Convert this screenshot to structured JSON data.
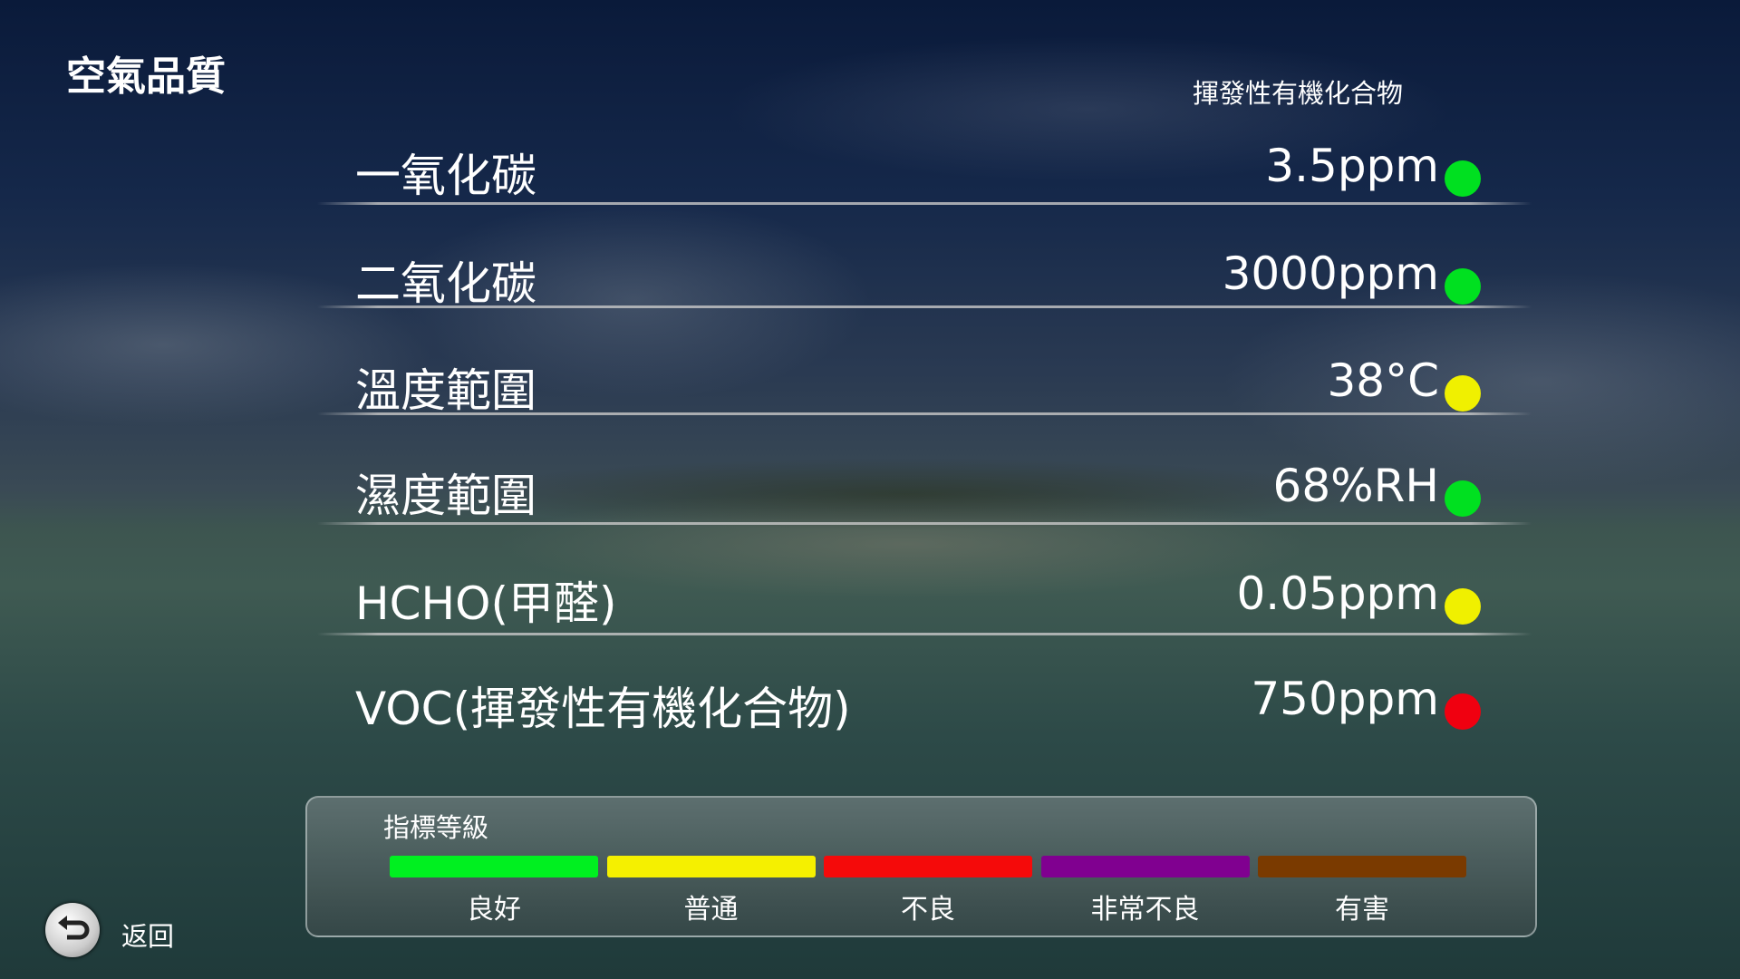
{
  "title": "空氣品質",
  "header": "揮發性有機化合物",
  "rows": [
    {
      "label": "一氧化碳",
      "value": "3.5ppm",
      "status_color": "#00e020"
    },
    {
      "label": "二氧化碳",
      "value": "3000ppm",
      "status_color": "#00e020"
    },
    {
      "label": "溫度範圍",
      "value": "38°C",
      "status_color": "#f0f000"
    },
    {
      "label": "濕度範圍",
      "value": "68%RH",
      "status_color": "#00e020"
    },
    {
      "label": "HCHO(甲醛)",
      "value": "0.05ppm",
      "status_color": "#f0f000"
    },
    {
      "label": "VOC(揮發性有機化合物)",
      "value": "750ppm",
      "status_color": "#f00010"
    }
  ],
  "legend": {
    "title": "指標等級",
    "levels": [
      {
        "label": "良好",
        "color": "#00f020"
      },
      {
        "label": "普通",
        "color": "#f5f000"
      },
      {
        "label": "不良",
        "color": "#f50a0a"
      },
      {
        "label": "非常不良",
        "color": "#800090"
      },
      {
        "label": "有害",
        "color": "#7a3a00"
      }
    ]
  },
  "back": {
    "label": "返回",
    "icon": "back-arrow-icon"
  }
}
